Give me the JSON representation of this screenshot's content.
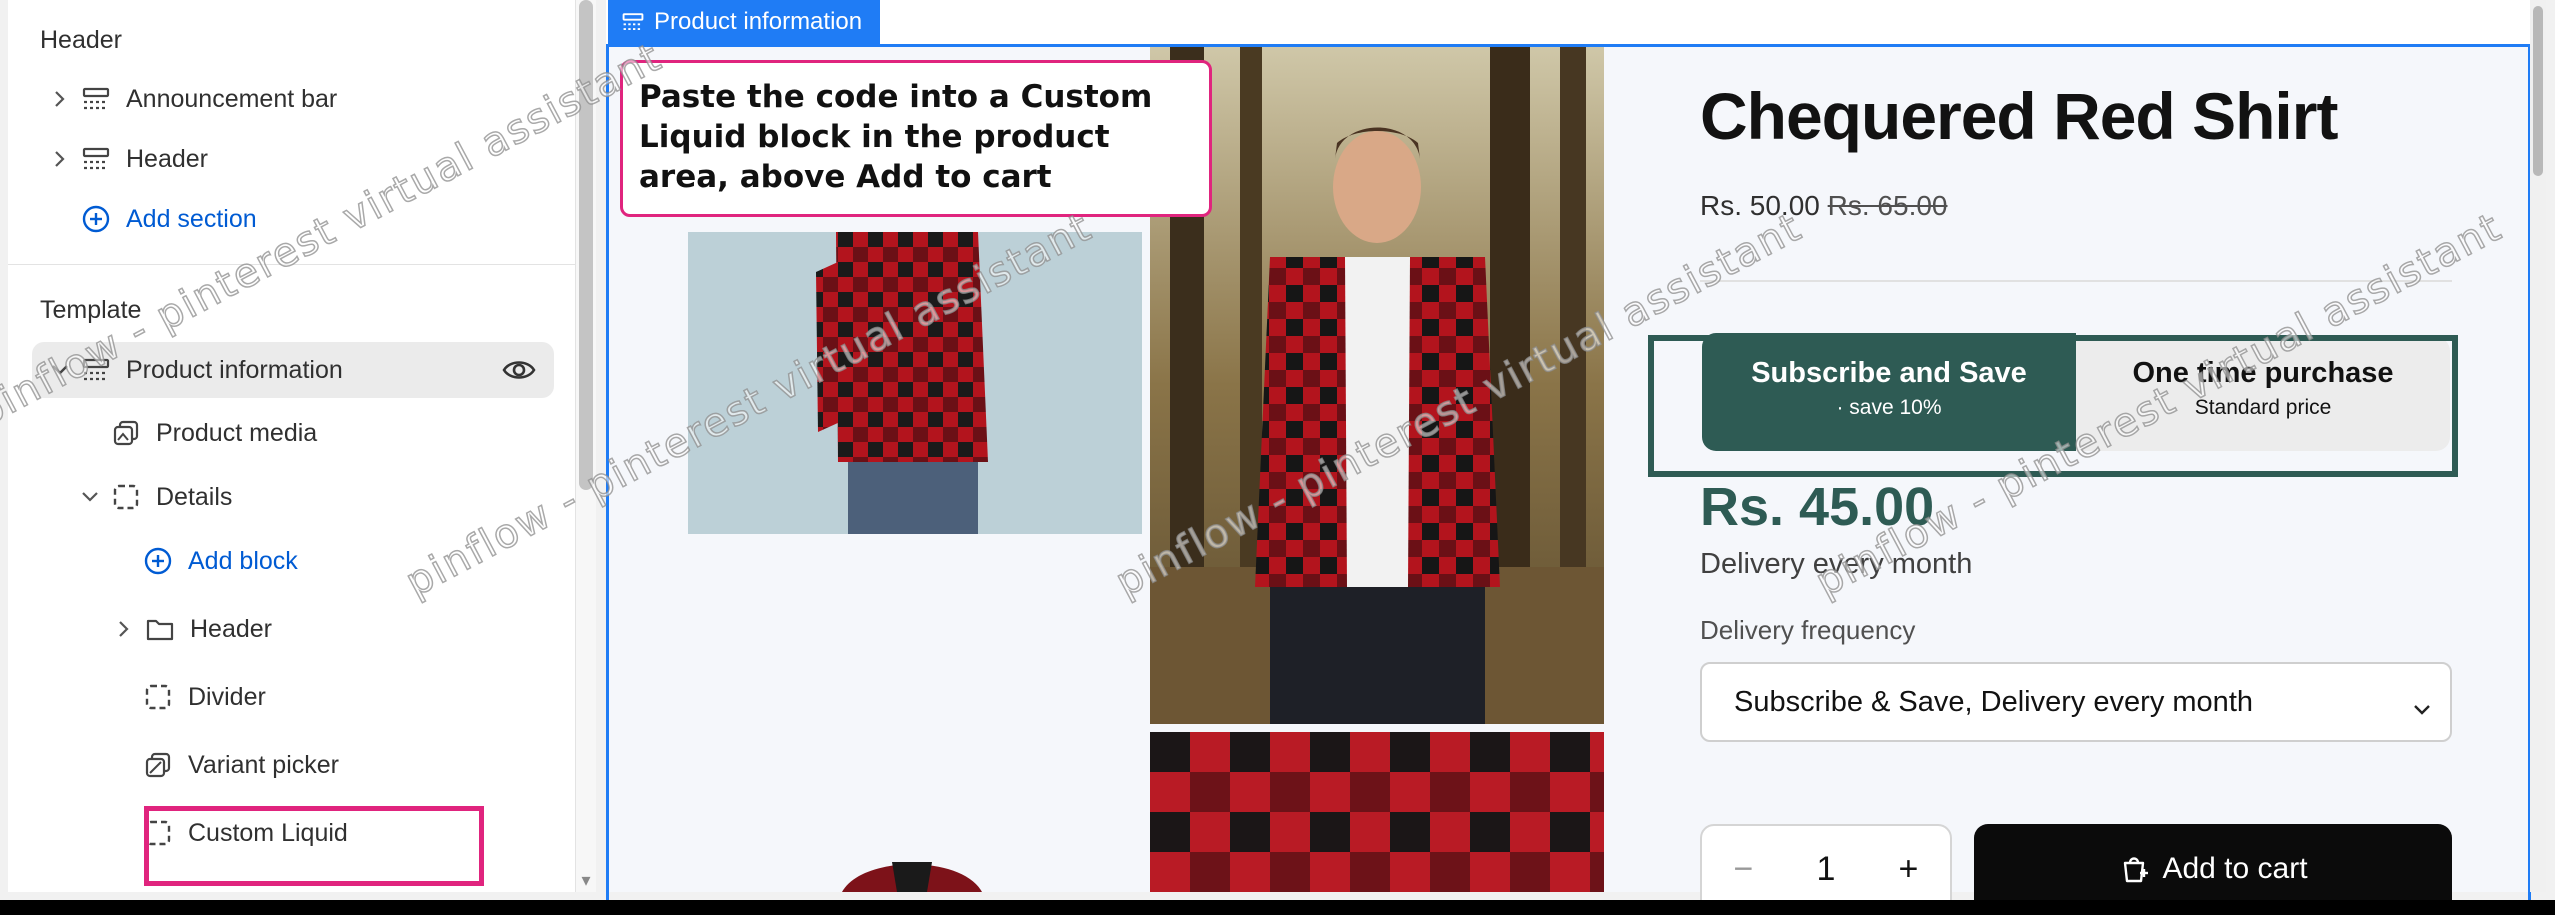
{
  "sidebar": {
    "header_section_title": "Header",
    "header_items": [
      {
        "label": "Announcement bar",
        "icon": "section-icon"
      },
      {
        "label": "Header",
        "icon": "section-icon"
      }
    ],
    "add_section_label": "Add section",
    "template_title": "Template",
    "product_information_label": "Product information",
    "product_media_label": "Product media",
    "details_label": "Details",
    "add_block_label": "Add block",
    "blocks": [
      {
        "label": "Header",
        "icon": "folder-icon"
      },
      {
        "label": "Divider",
        "icon": "block-icon"
      },
      {
        "label": "Variant picker",
        "icon": "variant-icon"
      },
      {
        "label": "Custom Liquid",
        "icon": "block-icon"
      }
    ]
  },
  "preview": {
    "section_tab_label": "Product information",
    "callout_text": "Paste the code into a Custom Liquid block in the product area, above Add to cart",
    "product": {
      "title": "Chequered Red Shirt",
      "price": "Rs. 50.00",
      "compare_price": "Rs. 65.00",
      "subscription_option": {
        "title": "Subscribe and Save",
        "subtitle": "· save 10%"
      },
      "one_time_option": {
        "title": "One time purchase",
        "subtitle": "Standard price"
      },
      "subscription_price": "Rs. 45.00",
      "delivery_text": "Delivery every month",
      "frequency_label": "Delivery frequency",
      "frequency_value": "Subscribe & Save, Delivery every month",
      "quantity": "1",
      "add_to_cart_label": "Add to cart"
    }
  },
  "watermark_text": "pinflow - pinterest virtual assistant",
  "colors": {
    "accent_blue": "#1f7cf5",
    "link_blue": "#005bd3",
    "highlight_pink": "#e0247e",
    "subscription_green": "#2e5b54",
    "button_black": "#0b0b0b"
  }
}
